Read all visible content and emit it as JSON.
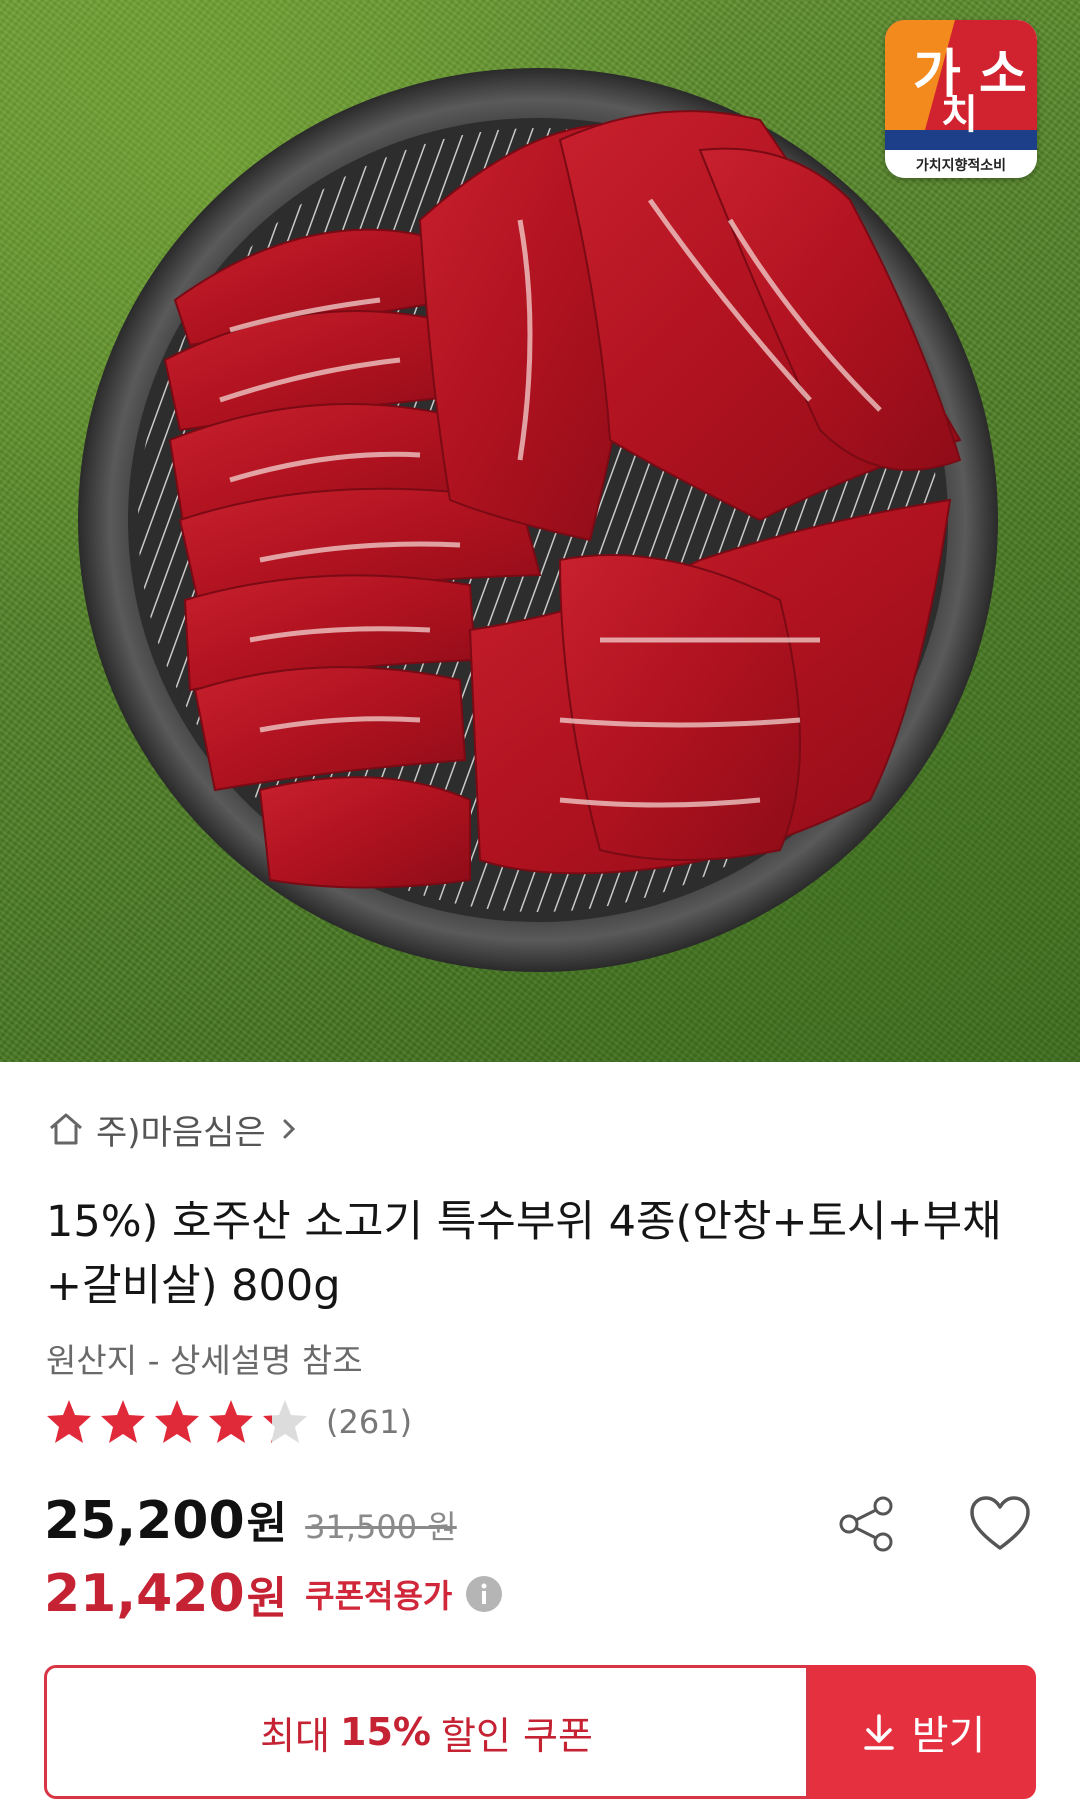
{
  "product_image": {
    "description_icon": "grilled-beef-photo",
    "badge": {
      "line1": "가 소",
      "line2": "치",
      "tagline": "가치지향적소비"
    }
  },
  "store": {
    "name": "주)마음심은",
    "icon": "home-icon"
  },
  "product": {
    "title": "15%) 호주산 소고기 특수부위 4종(안창+토시+부채+갈비살) 800g",
    "origin": "원산지 - 상세설명 참조",
    "rating": 4.2,
    "review_count": "(261)"
  },
  "price": {
    "sale_value": "25,200",
    "sale_unit": "원",
    "original": "31,500 원",
    "coupon_value": "21,420",
    "coupon_unit": "원",
    "coupon_label": "쿠폰적용가"
  },
  "coupon": {
    "prefix": "최대",
    "percent": "15%",
    "suffix": "할인 쿠폰",
    "download_label": "받기"
  },
  "colors": {
    "accent_red": "#c52233",
    "button_red": "#e53040",
    "star_red": "#e02a3a"
  }
}
